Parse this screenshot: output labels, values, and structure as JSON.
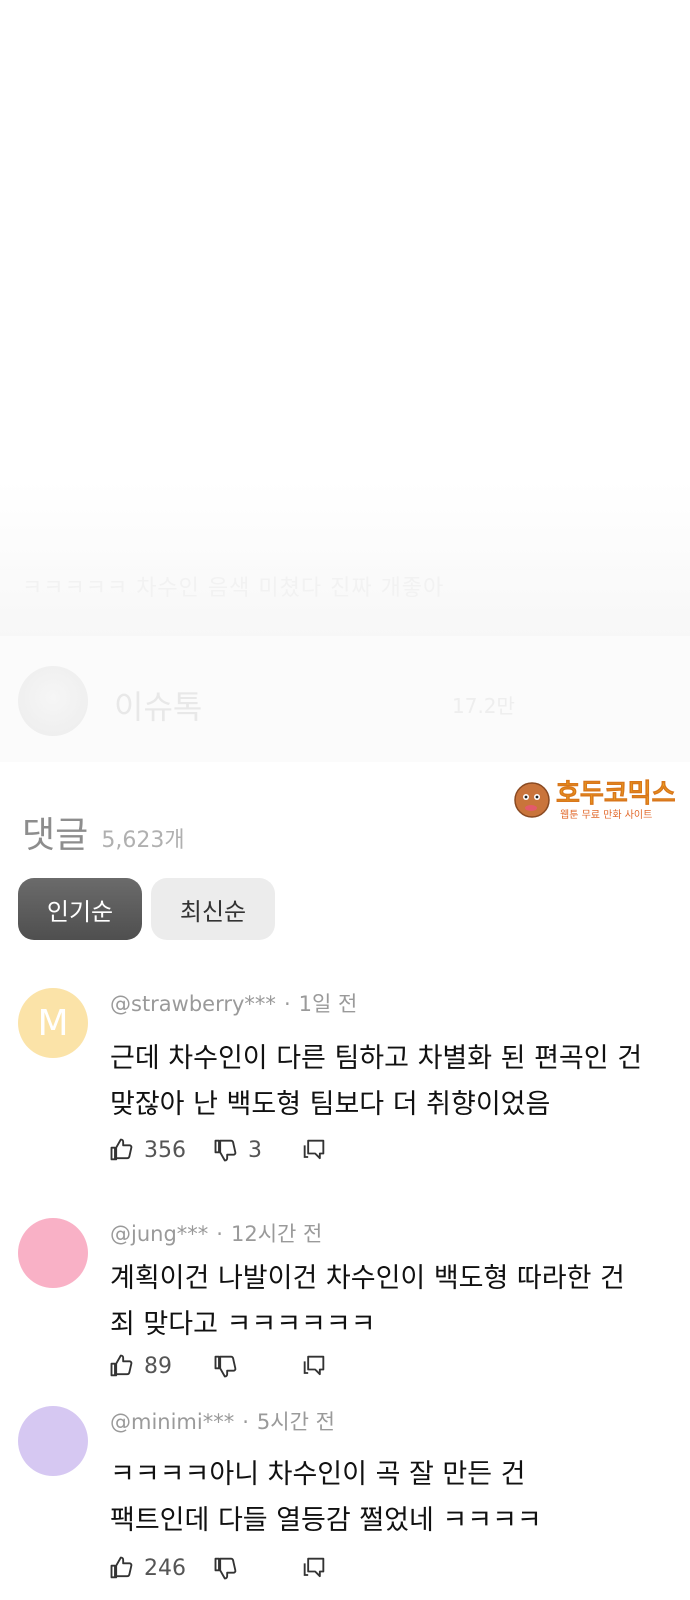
{
  "ghost_caption": "ㅋㅋㅋㅋㅋ 차수인 음색 미쳤다 진짜 개좋아",
  "channel": {
    "name": "이슈톡",
    "count": "17.2만"
  },
  "watermark": {
    "title": "호두코믹스",
    "subtitle": "웹툰 무료 만화 사이트"
  },
  "comments_section": {
    "title": "댓글",
    "count": "5,623개",
    "sort": {
      "popular": "인기순",
      "latest": "최신순"
    }
  },
  "comments": [
    {
      "avatar_letter": "M",
      "avatar_color": "#FBE3A8",
      "author": "@strawberry***",
      "separator": "·",
      "time": "1일 전",
      "lines": [
        "근데 차수인이 다른 팀하고 차별화 된 편곡인 건",
        "맞잖아 난 백도형 팀보다 더 취향이었음"
      ],
      "likes": "356",
      "dislikes": "3"
    },
    {
      "avatar_letter": "",
      "avatar_color": "#F9B1C6",
      "author": "@jung***",
      "separator": "·",
      "time": "12시간 전",
      "lines": [
        "계획이건 나발이건 차수인이 백도형 따라한 건",
        "죄 맞다고 ㅋㅋㅋㅋㅋㅋ"
      ],
      "likes": "89",
      "dislikes": ""
    },
    {
      "avatar_letter": "",
      "avatar_color": "#D6C8F2",
      "author": "@minimi***",
      "separator": "·",
      "time": "5시간 전",
      "lines": [
        "ㅋㅋㅋㅋ아니 차수인이 곡 잘 만든 건",
        "팩트인데 다들 열등감 쩔었네 ㅋㅋㅋㅋ"
      ],
      "likes": "246",
      "dislikes": ""
    }
  ],
  "icons": {
    "like": "thumbs-up-icon",
    "dislike": "thumbs-down-icon",
    "reply": "reply-icon"
  }
}
